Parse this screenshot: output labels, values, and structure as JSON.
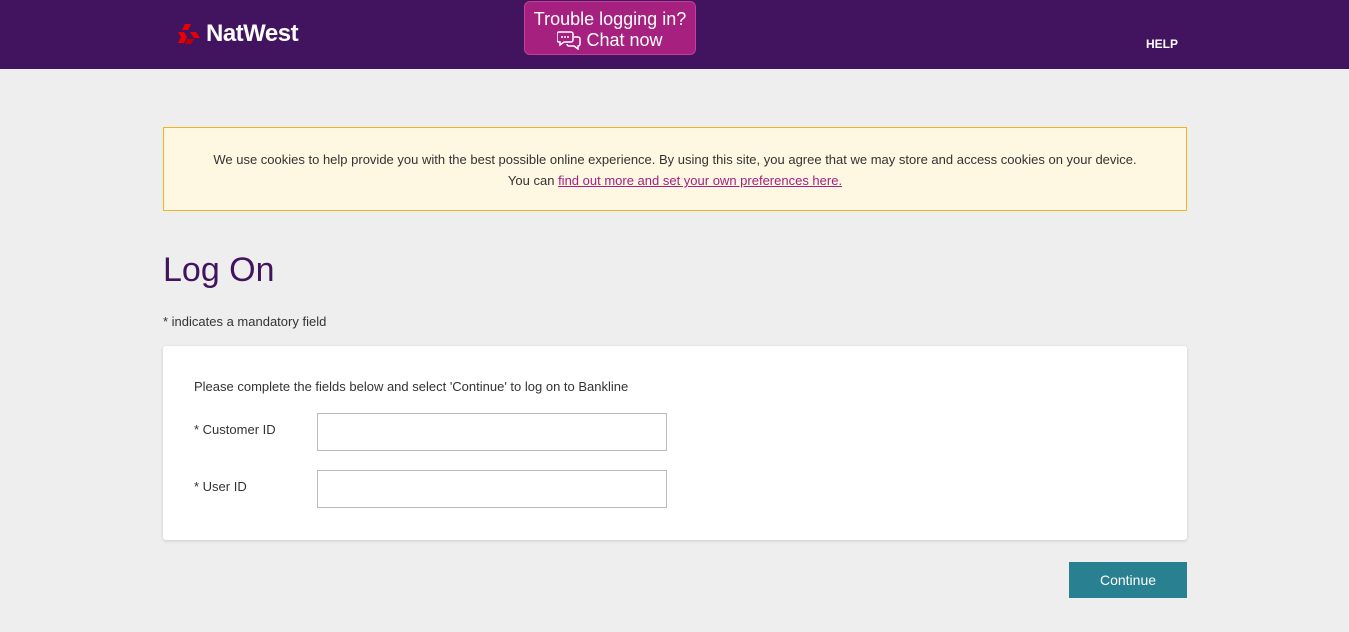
{
  "header": {
    "brand_name": "NatWest",
    "chat": {
      "line1": "Trouble logging in?",
      "line2": "Chat now"
    },
    "help_label": "HELP"
  },
  "cookie_banner": {
    "text_part1": "We use cookies to help provide you with the best possible online experience. By using this site, you agree that we may store and access cookies on your device.",
    "text_part2": "You can",
    "link_text": "find out more and set your own preferences here."
  },
  "page": {
    "title": "Log On",
    "mandatory_note": "* indicates a mandatory field"
  },
  "form": {
    "intro": "Please complete the fields below and select 'Continue' to log on to Bankline",
    "fields": [
      {
        "label": "* Customer ID",
        "value": ""
      },
      {
        "label": "* User ID",
        "value": ""
      }
    ]
  },
  "actions": {
    "continue_label": "Continue"
  },
  "colors": {
    "header_bg": "#42145f",
    "chat_bg": "#a6207f",
    "banner_bg": "#fef7e2",
    "banner_border": "#f0b323",
    "button_bg": "#288090",
    "title_color": "#42145f"
  },
  "icons": {
    "logo": "natwest-chevron-logo-icon",
    "chat": "chat-bubbles-icon"
  }
}
